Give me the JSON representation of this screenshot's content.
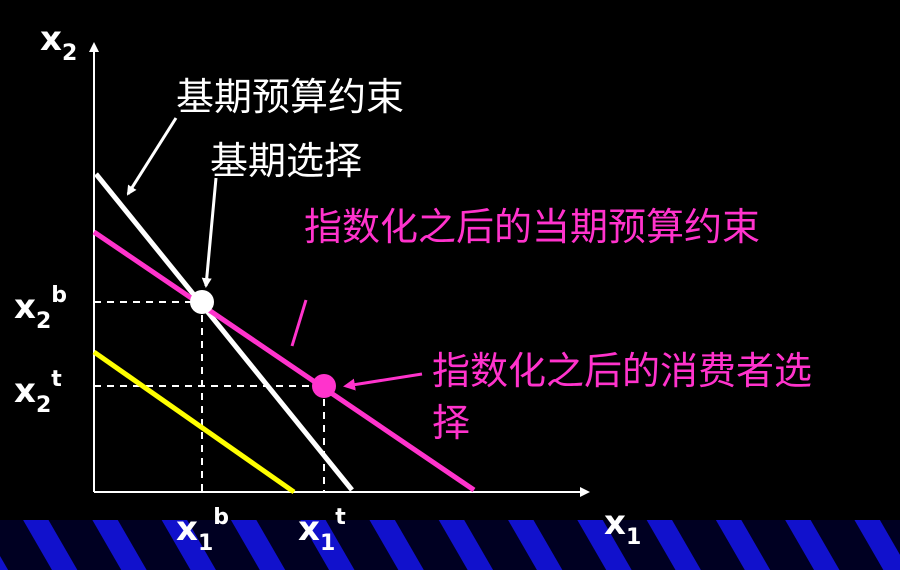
{
  "axes": {
    "y_label": {
      "main": "x",
      "sub": "2"
    },
    "x_label": {
      "main": "x",
      "sub": "1"
    }
  },
  "ticks": {
    "x2b": {
      "main": "x",
      "sub": "2",
      "sup": "b"
    },
    "x2t": {
      "main": "x",
      "sub": "2",
      "sup": "t"
    },
    "x1b": {
      "main": "x",
      "sub": "1",
      "sup": "b"
    },
    "x1t": {
      "main": "x",
      "sub": "1",
      "sup": "t"
    }
  },
  "annotations": {
    "base_budget": "基期预算约束",
    "base_choice": "基期选择",
    "indexed_budget": "指数化之后的当期预算约束",
    "indexed_choice_line1": "指数化之后的消费者选",
    "indexed_choice_line2": "择"
  },
  "colors": {
    "background": "#000000",
    "axis": "#ffffff",
    "base_budget_line": "#ffffff",
    "indexed_budget_line": "#ff33cc",
    "yellow_line": "#ffff00",
    "pink_text": "#ff33cc",
    "band_dark": "#000033",
    "band_stripe": "#1a1aff"
  }
}
